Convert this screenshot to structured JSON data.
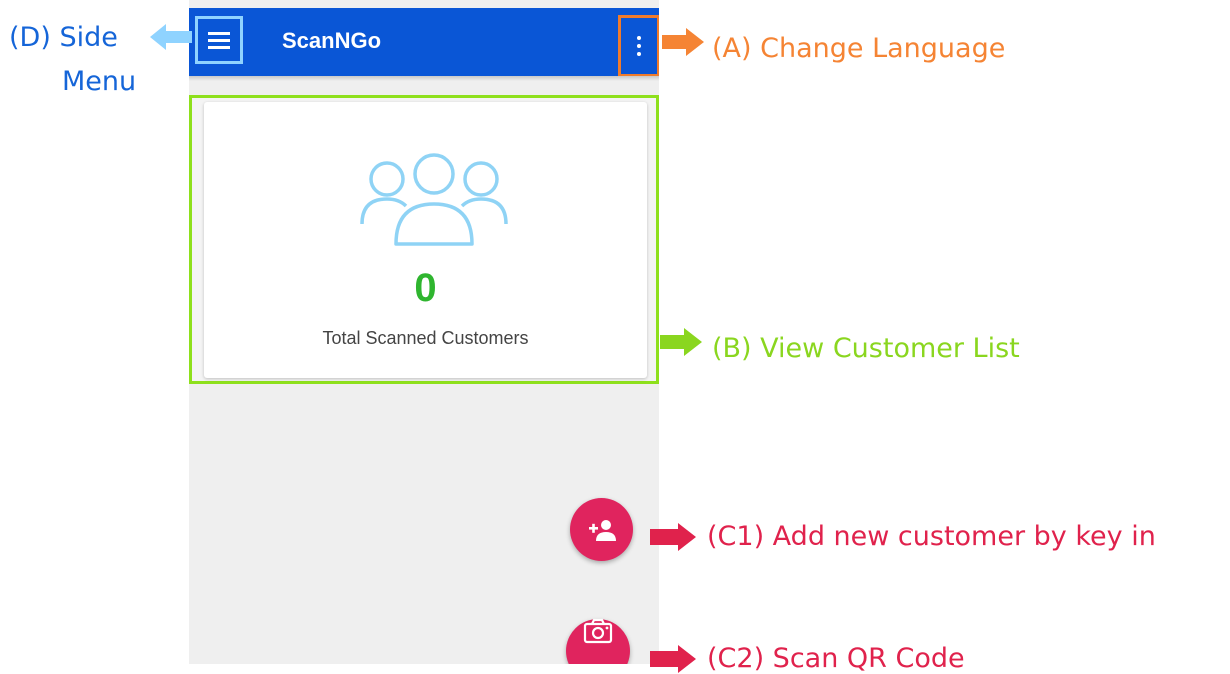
{
  "app": {
    "title": "ScanNGo"
  },
  "dashboard": {
    "count": "0",
    "count_label": "Total Scanned Customers"
  },
  "annotations": {
    "side_menu_line1": "(D) Side",
    "side_menu_line2": "Menu",
    "change_language": "(A) Change Language",
    "view_customer_list": "(B) View Customer List",
    "add_customer": "(C1) Add new customer by key in",
    "scan_qr": "(C2) Scan QR Code"
  },
  "icons": {
    "menu": "hamburger-menu-icon",
    "overflow": "vertical-dots-icon",
    "customers": "people-group-icon",
    "add": "add-person-icon",
    "scan": "camera-icon"
  },
  "colors": {
    "appbar": "#0a56d6",
    "fab": "#e0245e",
    "count": "#2fb52f",
    "anno_side_menu": "#1565d8",
    "anno_language": "#f58434",
    "anno_customer_list": "#8ad61f",
    "anno_add_scan": "#e0224c"
  }
}
